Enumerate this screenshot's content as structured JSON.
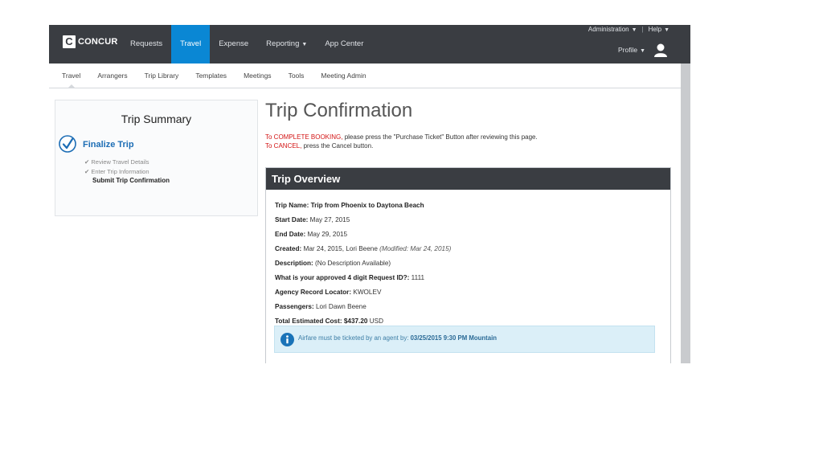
{
  "brand": {
    "logo_letter": "C",
    "logo_text": "CONCUR"
  },
  "topnav": {
    "items": [
      {
        "label": "Requests"
      },
      {
        "label": "Travel",
        "active": true
      },
      {
        "label": "Expense"
      },
      {
        "label": "Reporting"
      },
      {
        "label": "App Center"
      }
    ],
    "administration": "Administration",
    "help": "Help",
    "profile": "Profile",
    "active_color": "#0a87d4"
  },
  "subnav": {
    "tabs": [
      "Travel",
      "Arrangers",
      "Trip Library",
      "Templates",
      "Meetings",
      "Tools",
      "Meeting Admin"
    ]
  },
  "summary": {
    "title": "Trip Summary",
    "heading": "Finalize Trip",
    "steps": [
      {
        "label": "Review Travel Details",
        "done": true
      },
      {
        "label": "Enter Trip Information",
        "done": true
      },
      {
        "label": "Submit Trip Confirmation",
        "done": false
      }
    ]
  },
  "main": {
    "title": "Trip Confirmation",
    "instr1_red": "To COMPLETE BOOKING,",
    "instr1_rest": " please press the \"Purchase Ticket\" Button after reviewing this page.",
    "instr2_red": "To CANCEL,",
    "instr2_rest": " press the Cancel button."
  },
  "overview": {
    "heading": "Trip Overview",
    "trip_name_label": "Trip Name: Trip from Phoenix to Daytona Beach",
    "start_label": "Start Date:",
    "start_value": " May 27, 2015",
    "end_label": "End Date:",
    "end_value": " May 29, 2015",
    "created_label": "Created:",
    "created_value": " Mar 24, 2015, Lori Beene ",
    "created_modified": "(Modified: Mar 24, 2015)",
    "description_label": "Description:",
    "description_value": " (No Description Available)",
    "request_label": "What is your approved 4 digit Request ID?:",
    "request_value": " 1111",
    "locator_label": "Agency Record Locator:",
    "locator_value": " KWOLEV",
    "passengers_label": "Passengers:",
    "passengers_value": " Lori Dawn Beene",
    "cost_label": "Total Estimated Cost:",
    "cost_amount": " $437.20",
    "cost_currency": " USD",
    "alert_text": "Airfare must be ticketed by an agent by: ",
    "alert_deadline": "03/25/2015 9:30 PM Mountain"
  },
  "icons": [
    "concur-logo-icon",
    "user-avatar-icon",
    "checkmark-circle-icon",
    "info-icon",
    "caret-down-icon"
  ],
  "colors": {
    "topbar": "#3a3d42",
    "accent": "#0a87d4",
    "link": "#1c6db5",
    "warning_text": "#d31414",
    "alert_bg": "#dbeff8"
  }
}
